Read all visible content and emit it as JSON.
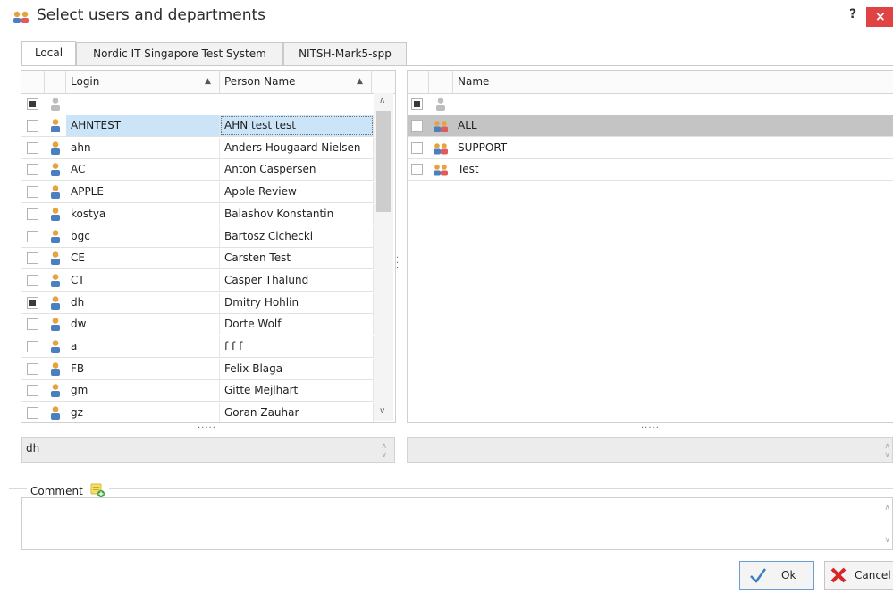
{
  "window": {
    "title": "Select users and departments",
    "help_label": "?",
    "close_label": "×"
  },
  "tabs": [
    {
      "label": "Local",
      "active": true
    },
    {
      "label": "Nordic IT Singapore Test System",
      "active": false
    },
    {
      "label": "NITSH-Mark5-spp",
      "active": false
    }
  ],
  "users_grid": {
    "columns": [
      "Login",
      "Person Name"
    ],
    "rows": [
      {
        "login": "AHNTEST",
        "name": "AHN test test",
        "checked": false,
        "selected": true
      },
      {
        "login": "ahn",
        "name": "Anders Hougaard Nielsen",
        "checked": false
      },
      {
        "login": "AC",
        "name": "Anton Caspersen",
        "checked": false
      },
      {
        "login": "APPLE",
        "name": "Apple Review",
        "checked": false
      },
      {
        "login": "kostya",
        "name": "Balashov Konstantin",
        "checked": false
      },
      {
        "login": "bgc",
        "name": "Bartosz Cichecki",
        "checked": false
      },
      {
        "login": "CE",
        "name": "Carsten Test",
        "checked": false
      },
      {
        "login": "CT",
        "name": "Casper Thalund",
        "checked": false
      },
      {
        "login": "dh",
        "name": "Dmitry Hohlin",
        "checked": true
      },
      {
        "login": "dw",
        "name": "Dorte Wolf",
        "checked": false
      },
      {
        "login": "a",
        "name": "f f f",
        "checked": false
      },
      {
        "login": "FB",
        "name": "Felix Blaga",
        "checked": false
      },
      {
        "login": "gm",
        "name": "Gitte Mejlhart",
        "checked": false
      },
      {
        "login": "gz",
        "name": "Goran Zauhar",
        "checked": false
      }
    ],
    "scroll_position": 0
  },
  "departments_grid": {
    "columns": [
      "Name"
    ],
    "rows": [
      {
        "name": "ALL",
        "checked": false,
        "selected": true
      },
      {
        "name": "SUPPORT",
        "checked": false
      },
      {
        "name": "Test",
        "checked": false
      }
    ]
  },
  "selected_users_text": "dh",
  "selected_departments_text": "",
  "comment": {
    "label": "Comment",
    "value": ""
  },
  "buttons": {
    "ok": "Ok",
    "cancel": "Cancel"
  },
  "colors": {
    "selected_row": "#cce4f7",
    "selected_dept_row": "#c4c4c4",
    "close_red": "#e04343",
    "accent_blue": "#3a7fc4"
  }
}
